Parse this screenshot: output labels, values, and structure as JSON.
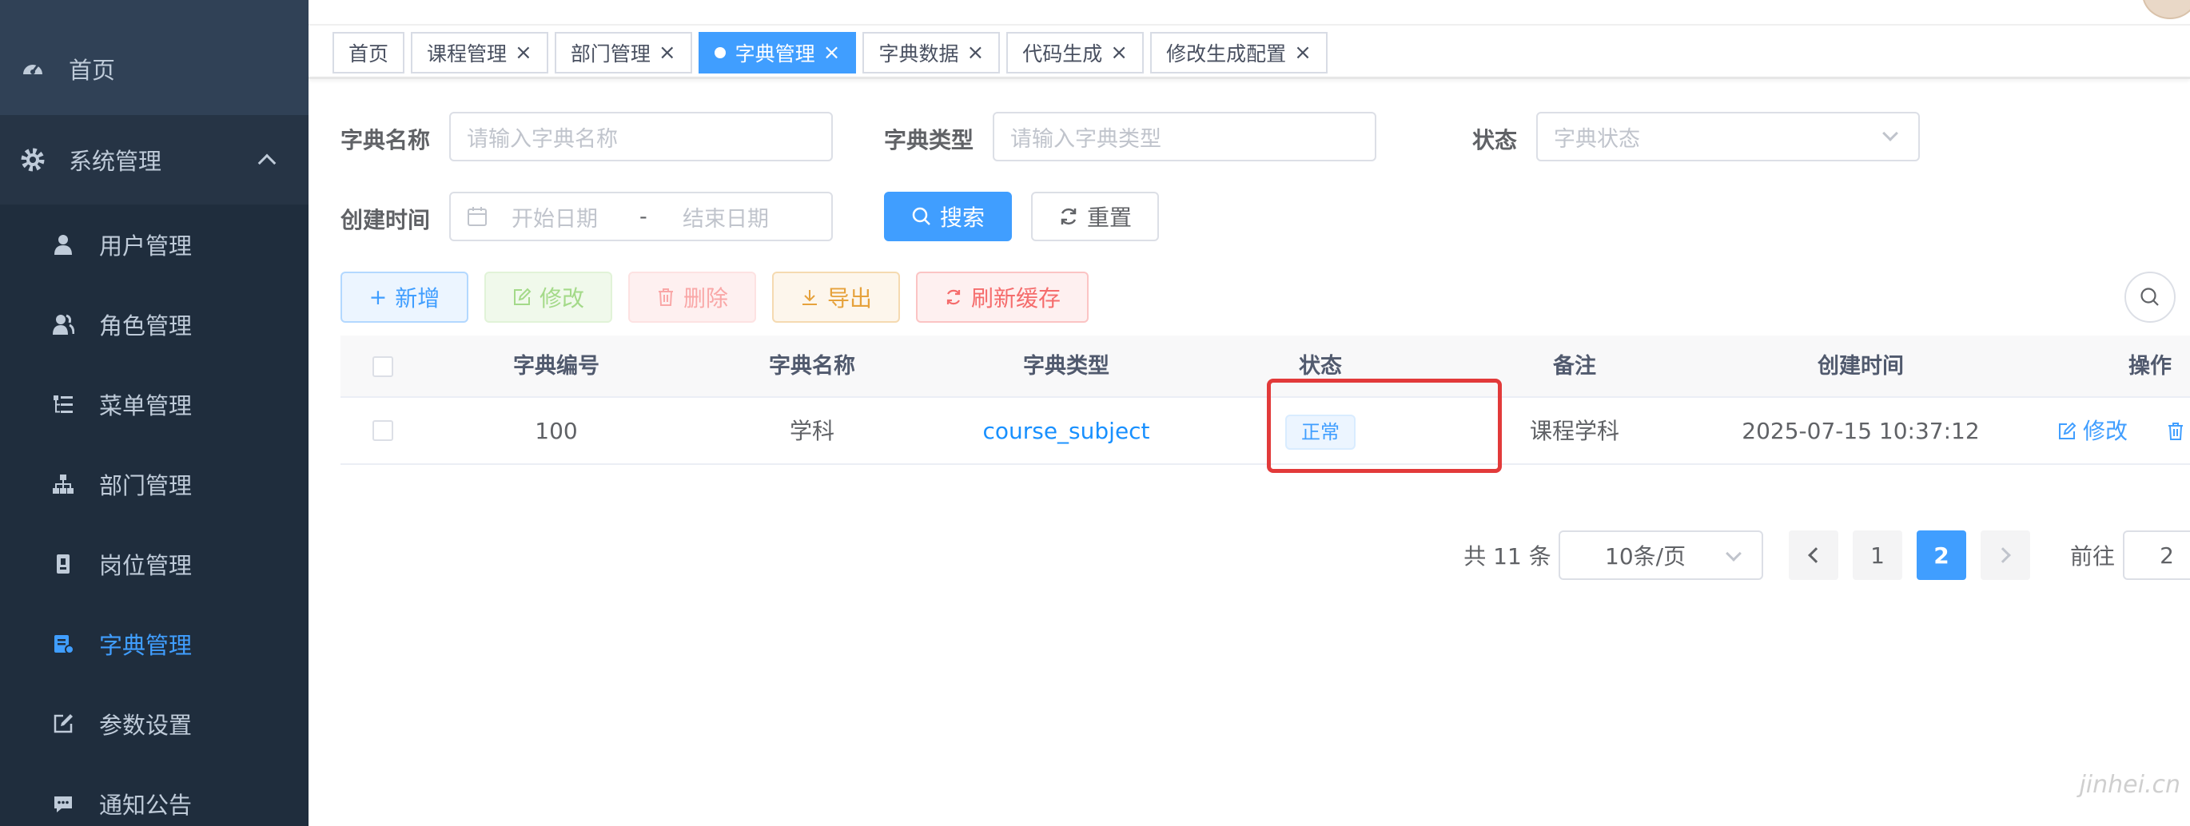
{
  "sidebar": {
    "items": [
      {
        "label": "首页",
        "icon": "dashboard-icon"
      },
      {
        "label": "系统管理",
        "icon": "gear-icon"
      }
    ],
    "submenu": [
      {
        "label": "用户管理",
        "icon": "user-icon"
      },
      {
        "label": "角色管理",
        "icon": "peoples-icon"
      },
      {
        "label": "菜单管理",
        "icon": "tree-table-icon"
      },
      {
        "label": "部门管理",
        "icon": "tree-icon"
      },
      {
        "label": "岗位管理",
        "icon": "post-icon"
      },
      {
        "label": "字典管理",
        "icon": "dict-icon",
        "active": true
      },
      {
        "label": "参数设置",
        "icon": "edit-icon"
      },
      {
        "label": "通知公告",
        "icon": "message-icon"
      }
    ]
  },
  "tags": [
    {
      "label": "首页",
      "closable": false
    },
    {
      "label": "课程管理",
      "closable": true
    },
    {
      "label": "部门管理",
      "closable": true
    },
    {
      "label": "字典管理",
      "closable": true,
      "active": true
    },
    {
      "label": "字典数据",
      "closable": true
    },
    {
      "label": "代码生成",
      "closable": true
    },
    {
      "label": "修改生成配置",
      "closable": true
    }
  ],
  "search": {
    "dict_name_label": "字典名称",
    "dict_name_placeholder": "请输入字典名称",
    "dict_type_label": "字典类型",
    "dict_type_placeholder": "请输入字典类型",
    "status_label": "状态",
    "status_placeholder": "字典状态",
    "create_time_label": "创建时间",
    "start_placeholder": "开始日期",
    "range_sep": "-",
    "end_placeholder": "结束日期",
    "search_btn": "搜索",
    "reset_btn": "重置"
  },
  "toolbar": {
    "add": "新增",
    "edit": "修改",
    "delete": "删除",
    "export": "导出",
    "refresh_cache": "刷新缓存"
  },
  "table": {
    "headers": [
      "字典编号",
      "字典名称",
      "字典类型",
      "状态",
      "备注",
      "创建时间",
      "操作"
    ],
    "rows": [
      {
        "id": "100",
        "name": "学科",
        "type": "course_subject",
        "status": "正常",
        "remark": "课程学科",
        "created": "2025-07-15 10:37:12",
        "action_edit": "修改",
        "action_delete": "删除"
      }
    ]
  },
  "pagination": {
    "total": "共 11 条",
    "page_size": "10条/页",
    "pages": [
      "1",
      "2"
    ],
    "current": "2",
    "goto_label": "前往",
    "goto_value": "2"
  },
  "watermark": "jinhei.cn",
  "colors": {
    "sidebar_bg": "#304156",
    "primary": "#409eff",
    "highlight": "#e23a3a"
  }
}
